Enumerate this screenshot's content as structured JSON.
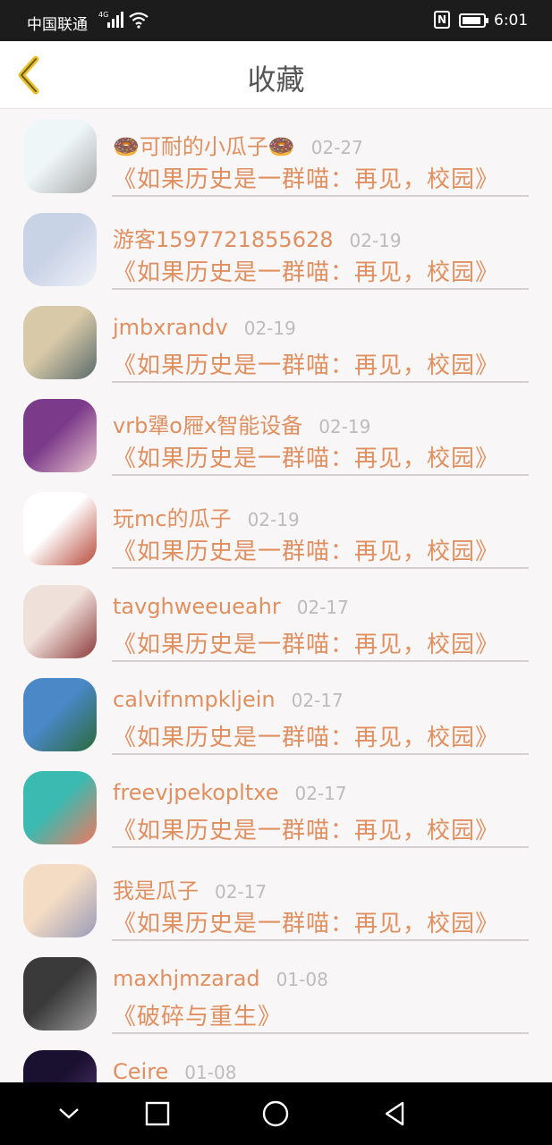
{
  "status_bar": {
    "carrier": "中国联通",
    "network": "4G",
    "time": "6:01"
  },
  "header": {
    "title": "收藏",
    "back_icon": "chevron-left-icon"
  },
  "favorites": [
    {
      "name": "🍩可耐的小瓜子🍩",
      "date": "02-27",
      "book": "《如果历史是一群喵：再见，校园》",
      "avatar_colors": [
        "#eef6f8",
        "#a9a9a9"
      ]
    },
    {
      "name": "游客1597721855628",
      "date": "02-19",
      "book": "《如果历史是一群喵：再见，校园》",
      "avatar_colors": [
        "#c9d3e6",
        "#eef1f8"
      ]
    },
    {
      "name": "jmbxrandv",
      "date": "02-19",
      "book": "《如果历史是一群喵：再见，校园》",
      "avatar_colors": [
        "#d8c9a8",
        "#5a6b6a"
      ]
    },
    {
      "name": "vrb犟o屜x智能设备",
      "date": "02-19",
      "book": "《如果历史是一群喵：再见，校园》",
      "avatar_colors": [
        "#7b3a8a",
        "#e8c4cc"
      ]
    },
    {
      "name": "玩mc的瓜子",
      "date": "02-19",
      "book": "《如果历史是一群喵：再见，校园》",
      "avatar_colors": [
        "#ffffff",
        "#b84a3a"
      ]
    },
    {
      "name": "tavghweeueahr",
      "date": "02-17",
      "book": "《如果历史是一群喵：再见，校园》",
      "avatar_colors": [
        "#f0e0da",
        "#8a3a3a"
      ]
    },
    {
      "name": "calvifnmpkljein",
      "date": "02-17",
      "book": "《如果历史是一群喵：再见，校园》",
      "avatar_colors": [
        "#4a88c8",
        "#2a6a3a"
      ]
    },
    {
      "name": "freevjpekopltxe",
      "date": "02-17",
      "book": "《如果历史是一群喵：再见，校园》",
      "avatar_colors": [
        "#3abab0",
        "#f07860"
      ]
    },
    {
      "name": "我是瓜子",
      "date": "02-17",
      "book": "《如果历史是一群喵：再见，校园》",
      "avatar_colors": [
        "#f4dcc4",
        "#9a9ab8"
      ]
    },
    {
      "name": "maxhjmzarad",
      "date": "01-08",
      "book": "《破碎与重生》",
      "avatar_colors": [
        "#3a3a3a",
        "#9a9a9a"
      ]
    },
    {
      "name": "Ceire",
      "date": "01-08",
      "book": "",
      "avatar_colors": [
        "#1a1030",
        "#5a3a7a"
      ]
    }
  ],
  "nav_bar": {
    "icons": [
      "chevron-down-icon",
      "square-icon",
      "circle-icon",
      "triangle-back-icon"
    ]
  },
  "colors": {
    "accent": "#e09060",
    "back_icon": "#e8c030",
    "date": "#bcbcbc"
  }
}
